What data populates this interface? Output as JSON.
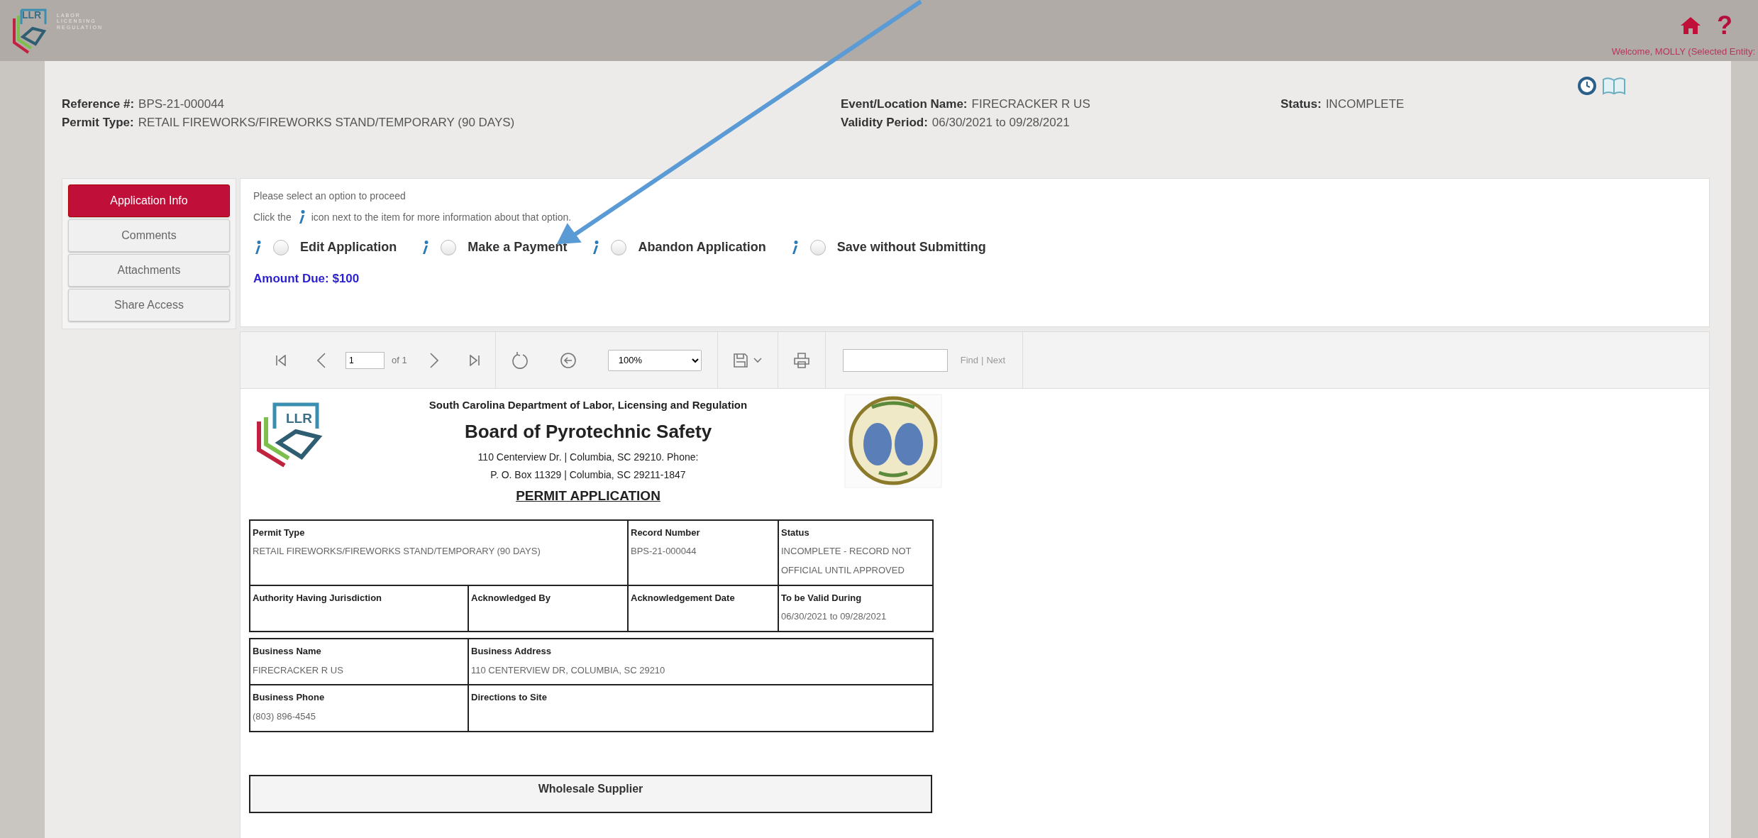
{
  "header": {
    "logo_mark": "LLR",
    "logo_lines": [
      "LABOR",
      "LICENSING",
      "REGULATION"
    ],
    "help_glyph": "?",
    "welcome": "Welcome, MOLLY (Selected Entity:"
  },
  "summary_columns": [
    [
      {
        "label": "Reference #:",
        "value": "BPS-21-000044"
      },
      {
        "label": "Permit Type:",
        "value": "RETAIL FIREWORKS/FIREWORKS STAND/TEMPORARY (90 DAYS)"
      }
    ],
    [
      {
        "label": "Event/Location Name:",
        "value": "FIRECRACKER R US"
      },
      {
        "label": "Validity Period:",
        "value": "06/30/2021 to 09/28/2021"
      }
    ],
    [
      {
        "label": "Status:",
        "value": "INCOMPLETE"
      }
    ]
  ],
  "side_tabs": [
    {
      "label": "Application Info",
      "selected": true
    },
    {
      "label": "Comments",
      "selected": false
    },
    {
      "label": "Attachments",
      "selected": false
    },
    {
      "label": "Share Access",
      "selected": false
    }
  ],
  "options_panel": {
    "prompt": "Please select an option to proceed",
    "hint_before": "Click the",
    "hint_after": "icon next to the item for more information about that option.",
    "options": [
      {
        "label": "Edit Application",
        "selected": false
      },
      {
        "label": "Make a Payment",
        "selected": false
      },
      {
        "label": "Abandon Application",
        "selected": false
      },
      {
        "label": "Save without Submitting",
        "selected": false
      }
    ],
    "amount_due": "Amount Due: $100"
  },
  "toolbar": {
    "page": "1",
    "page_of": "of 1",
    "zoom": "100%",
    "find_label": "Find",
    "separator": "|",
    "next_label": "Next",
    "find_disabled": true
  },
  "document": {
    "logo_mark": "LLR",
    "agency": "South Carolina Department of Labor, Licensing and Regulation",
    "board": "Board of Pyrotechnic Safety",
    "address_lines": [
      "110 Centerview Dr. | Columbia, SC 29210. Phone:",
      "P. O. Box 11329 | Columbia, SC 29211-1847"
    ],
    "form_title": "PERMIT APPLICATION",
    "permit_table": [
      [
        {
          "label": "Permit Type",
          "value": "RETAIL FIREWORKS/FIREWORKS STAND/TEMPORARY (90 DAYS)",
          "wide": true
        },
        {
          "label": "Record Number",
          "value": "BPS-21-000044"
        },
        {
          "label": "Status",
          "value": "INCOMPLETE - RECORD NOT OFFICIAL UNTIL APPROVED"
        }
      ],
      [
        {
          "label": "Authority Having Jurisdiction"
        },
        {
          "label": "Acknowledged By"
        },
        {
          "label": "Acknowledgement Date"
        },
        {
          "label": "To be Valid During",
          "value": "06/30/2021 to 09/28/2021"
        }
      ]
    ],
    "business_table": [
      [
        {
          "label": "Business Name",
          "value": "FIRECRACKER R US"
        },
        {
          "label": "Business Address",
          "value": "110 CENTERVIEW DR, COLUMBIA, SC 29210"
        }
      ],
      [
        {
          "label": "Business Phone",
          "value": "(803) 896-4545"
        },
        {
          "label": "Directions to Site"
        }
      ]
    ],
    "wholesale_heading": "Wholesale Supplier"
  }
}
